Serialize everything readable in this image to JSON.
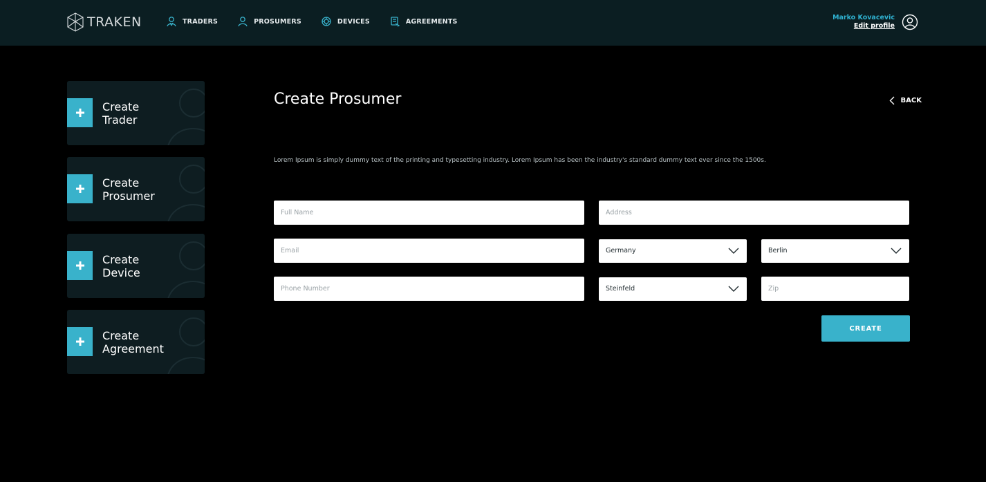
{
  "header": {
    "logo_text": "TRAKEN",
    "nav": [
      {
        "label": "TRADERS",
        "icon": "traders-icon"
      },
      {
        "label": "PROSUMERS",
        "icon": "prosumers-icon"
      },
      {
        "label": "DEVICES",
        "icon": "devices-icon"
      },
      {
        "label": "AGREEMENTS",
        "icon": "agreements-icon"
      }
    ],
    "user": {
      "name": "Marko Kovacevic",
      "edit_label": "Edit profile"
    }
  },
  "sidebar": {
    "cards": [
      {
        "label": "Create\nTrader"
      },
      {
        "label": "Create\nProsumer"
      },
      {
        "label": "Create\nDevice"
      },
      {
        "label": "Create\nAgreement"
      }
    ]
  },
  "main": {
    "title": "Create Prosumer",
    "back_label": "BACK",
    "description": "Lorem Ipsum is simply dummy text of the printing and typesetting industry. Lorem Ipsum has been the industry's standard dummy text ever since the 1500s.",
    "form": {
      "full_name_placeholder": "Full Name",
      "address_placeholder": "Address",
      "email_placeholder": "Email",
      "country_value": "Germany",
      "city_value": "Berlin",
      "phone_placeholder": "Phone Number",
      "district_value": "Steinfeld",
      "zip_placeholder": "Zip",
      "submit_label": "CREATE"
    }
  },
  "colors": {
    "accent": "#39b2cb",
    "header_bg": "#0b1e22",
    "card_bg": "#0e1d21",
    "page_bg": "#000000"
  }
}
